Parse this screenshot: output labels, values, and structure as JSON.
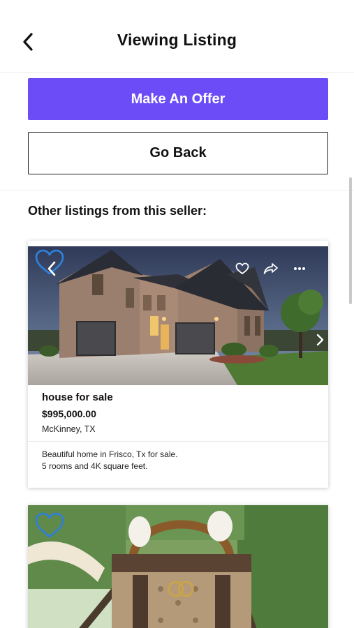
{
  "header": {
    "title": "Viewing Listing",
    "back_icon": "chevron-left-icon"
  },
  "actions": {
    "make_offer_label": "Make An Offer",
    "go_back_label": "Go Back",
    "accent_color": "#6b4cf6"
  },
  "section": {
    "title": "Other listings from this seller:"
  },
  "listings": [
    {
      "title": "house for sale",
      "price": "$995,000.00",
      "location": "McKinney, TX",
      "description_line1": "Beautiful home in Frisco, Tx for sale.",
      "description_line2": "5 rooms and 4K square feet.",
      "image": "brick-house-photo",
      "icons": [
        "heart-icon",
        "chevron-left-icon",
        "heart-outline-icon",
        "share-icon",
        "more-icon",
        "chevron-right-icon"
      ]
    },
    {
      "image": "designer-handbag-photo",
      "brand_text": "GUCCI",
      "icons": [
        "heart-icon"
      ]
    }
  ]
}
